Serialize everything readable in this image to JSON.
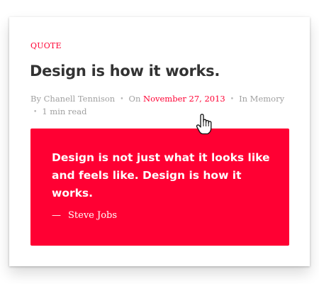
{
  "post": {
    "category": "QUOTE",
    "title": "Design is how it works.",
    "meta": {
      "by_prefix": "By",
      "author": "Chanell Tennison",
      "on_prefix": "On",
      "date": "November 27, 2013",
      "in_prefix": "In",
      "category": "Memory",
      "read_time": "1 min read",
      "separator": "•"
    },
    "quote": {
      "text": "Design is not just what it looks like and feels like. Design is how it works.",
      "dash": "—",
      "author": "Steve Jobs"
    }
  },
  "cursor": {
    "icon": "hand-pointer-icon"
  },
  "colors": {
    "accent": "#ff0033",
    "title": "#333333",
    "meta": "#a0a0a0"
  }
}
